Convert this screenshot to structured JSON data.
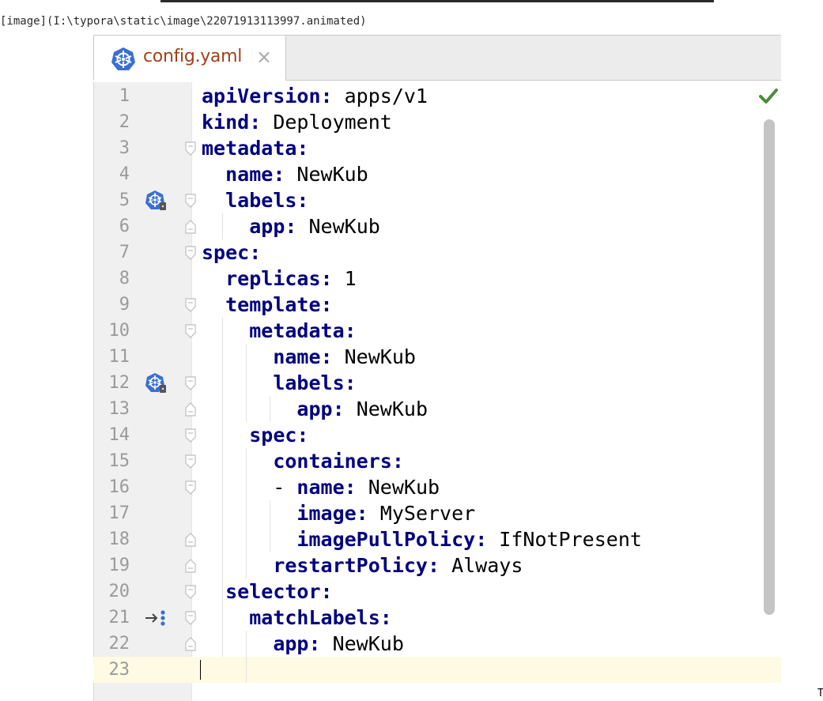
{
  "alt_text": "[image](I:\\typora\\static\\image\\22071913113997.animated)",
  "corner_char": "T",
  "tab": {
    "filename": "config.yaml",
    "close_glyph": "×",
    "icon": "kubernetes-icon"
  },
  "status": {
    "inspection_icon": "green-check-icon",
    "color": "#4c8a3f"
  },
  "colors": {
    "key": "#000080",
    "filename": "#a0401a",
    "caret_line": "#fffae3"
  },
  "gutter_icons": [
    {
      "line": 5,
      "icon": "kubernetes-label-icon"
    },
    {
      "line": 12,
      "icon": "kubernetes-label-icon"
    },
    {
      "line": 21,
      "icon": "selector-navigate-icon"
    }
  ],
  "lines": [
    {
      "num": "1",
      "indent": "",
      "key": "apiVersion:",
      "value": " apps/v1"
    },
    {
      "num": "2",
      "indent": "",
      "key": "kind:",
      "value": " Deployment"
    },
    {
      "num": "3",
      "indent": "",
      "key": "metadata:",
      "value": ""
    },
    {
      "num": "4",
      "indent": "  ",
      "key": "name:",
      "value": " NewKub"
    },
    {
      "num": "5",
      "indent": "  ",
      "key": "labels:",
      "value": ""
    },
    {
      "num": "6",
      "indent": "    ",
      "key": "app:",
      "value": " NewKub"
    },
    {
      "num": "7",
      "indent": "",
      "key": "spec:",
      "value": ""
    },
    {
      "num": "8",
      "indent": "  ",
      "key": "replicas:",
      "value": " 1"
    },
    {
      "num": "9",
      "indent": "  ",
      "key": "template:",
      "value": ""
    },
    {
      "num": "10",
      "indent": "    ",
      "key": "metadata:",
      "value": ""
    },
    {
      "num": "11",
      "indent": "      ",
      "key": "name:",
      "value": " NewKub"
    },
    {
      "num": "12",
      "indent": "      ",
      "key": "labels:",
      "value": ""
    },
    {
      "num": "13",
      "indent": "        ",
      "key": "app:",
      "value": " NewKub"
    },
    {
      "num": "14",
      "indent": "    ",
      "key": "spec:",
      "value": ""
    },
    {
      "num": "15",
      "indent": "      ",
      "key": "containers:",
      "value": ""
    },
    {
      "num": "16",
      "indent": "      - ",
      "key": "name:",
      "value": " NewKub"
    },
    {
      "num": "17",
      "indent": "        ",
      "key": "image:",
      "value": " MyServer"
    },
    {
      "num": "18",
      "indent": "        ",
      "key": "imagePullPolicy:",
      "value": " IfNotPresent"
    },
    {
      "num": "19",
      "indent": "      ",
      "key": "restartPolicy:",
      "value": " Always"
    },
    {
      "num": "20",
      "indent": "  ",
      "key": "selector:",
      "value": ""
    },
    {
      "num": "21",
      "indent": "    ",
      "key": "matchLabels:",
      "value": ""
    },
    {
      "num": "22",
      "indent": "      ",
      "key": "app:",
      "value": " NewKub"
    },
    {
      "num": "23",
      "indent": "",
      "key": "",
      "value": ""
    }
  ]
}
